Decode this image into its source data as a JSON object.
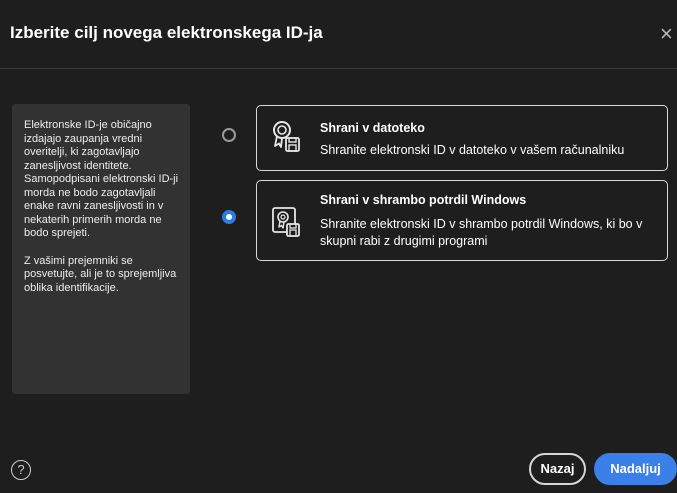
{
  "dialog": {
    "title": "Izberite cilj novega elektronskega ID-ja",
    "close_label": "×"
  },
  "info": {
    "paragraph_1": "Elektronske ID-je običajno izdajajo zaupanja vredni overitelji, ki zagotavljajo zanesljivost identitete. Samopodpisani elektronski ID-ji morda ne bodo zagotavljali enake ravni zanesljivosti in v nekaterih primerih morda ne bodo sprejeti.",
    "paragraph_2": "Z vašimi prejemniki se posvetujte, ali je to sprejemljiva oblika identifikacije."
  },
  "options": [
    {
      "title": "Shrani v datoteko",
      "description": "Shranite elektronski ID v datoteko v vašem računalniku",
      "selected": false,
      "icon": "certificate-file-icon"
    },
    {
      "title": "Shrani v shrambo potrdil Windows",
      "description": "Shranite elektronski ID v shrambo potrdil Windows, ki bo v skupni rabi z drugimi programi",
      "selected": true,
      "icon": "certificate-store-icon"
    }
  ],
  "footer": {
    "help_label": "?",
    "back_label": "Nazaj",
    "continue_label": "Nadaljuj"
  },
  "colors": {
    "background": "#1e1e1e",
    "panel": "#323232",
    "accent": "#3b80e8",
    "radio_selected": "#2d7be5"
  }
}
